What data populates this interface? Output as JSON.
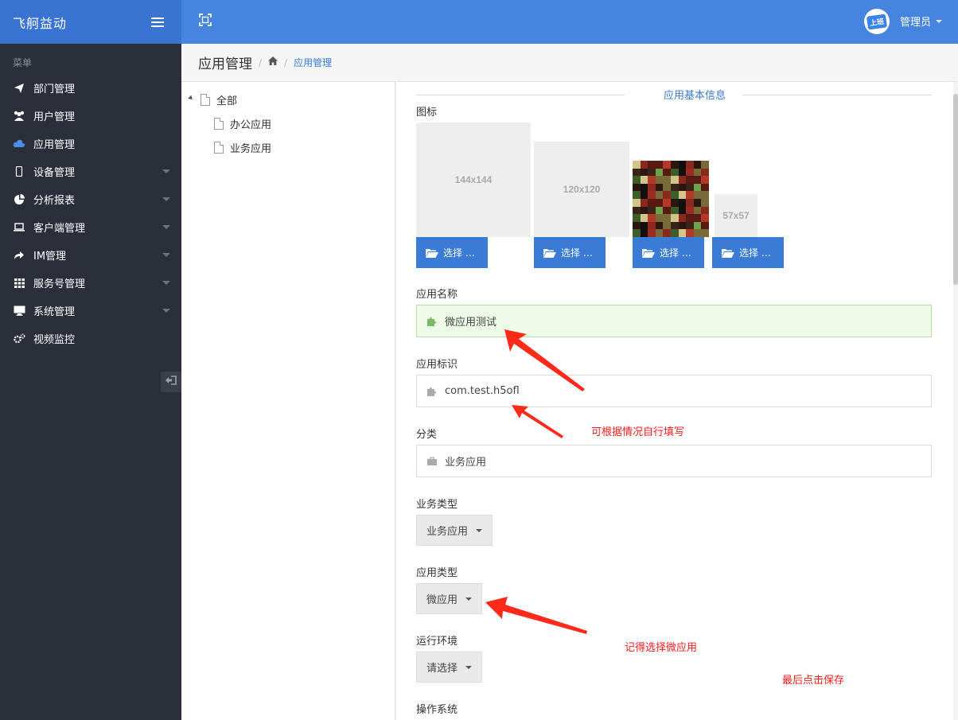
{
  "app": {
    "title": "飞舸益动"
  },
  "sidebar": {
    "heading": "菜单",
    "items": [
      {
        "label": "部门管理",
        "icon": "paper-plane-icon",
        "has_submenu": false
      },
      {
        "label": "用户管理",
        "icon": "users-icon",
        "has_submenu": false
      },
      {
        "label": "应用管理",
        "icon": "cloud-icon",
        "has_submenu": false,
        "active": true
      },
      {
        "label": "设备管理",
        "icon": "mobile-icon",
        "has_submenu": true
      },
      {
        "label": "分析报表",
        "icon": "pie-chart-icon",
        "has_submenu": true
      },
      {
        "label": "客户端管理",
        "icon": "laptop-icon",
        "has_submenu": true
      },
      {
        "label": "IM管理",
        "icon": "share-icon",
        "has_submenu": true
      },
      {
        "label": "服务号管理",
        "icon": "grid-icon",
        "has_submenu": true
      },
      {
        "label": "系统管理",
        "icon": "desktop-icon",
        "has_submenu": true
      },
      {
        "label": "视频监控",
        "icon": "gears-icon",
        "has_submenu": false
      }
    ]
  },
  "header": {
    "user": "管理员",
    "avatar_text": "上班"
  },
  "breadcrumb": {
    "page_title": "应用管理",
    "current": "应用管理"
  },
  "tree": {
    "root": "全部",
    "children": [
      "办公应用",
      "业务应用"
    ]
  },
  "form": {
    "section_title": "应用基本信息",
    "icon_label": "图标",
    "icon_slots": [
      {
        "size_text": "144x144",
        "button": "选择 …"
      },
      {
        "size_text": "120x120",
        "button": "选择 …"
      },
      {
        "size_text": "",
        "button": "选择 …"
      },
      {
        "size_text": "57x57",
        "button": "选择 …"
      }
    ],
    "name_label": "应用名称",
    "name_value": "微应用测试",
    "id_label": "应用标识",
    "id_value": "com.test.h5ofl",
    "category_label": "分类",
    "category_value": "业务应用",
    "biz_type_label": "业务类型",
    "biz_type_value": "业务应用",
    "app_type_label": "应用类型",
    "app_type_value": "微应用",
    "runtime_label": "运行环境",
    "runtime_value": "请选择",
    "os_label": "操作系统"
  },
  "annotations": {
    "fill_note": "可根据情况自行填写",
    "choose_note": "记得选择微应用",
    "save_note": "最后点击保存"
  },
  "colors": {
    "brand": "#3a74d2",
    "topbar": "#4585e0",
    "sidebar": "#2a2f3a",
    "link": "#3a7bd5",
    "annotation": "#ff1a1a"
  }
}
